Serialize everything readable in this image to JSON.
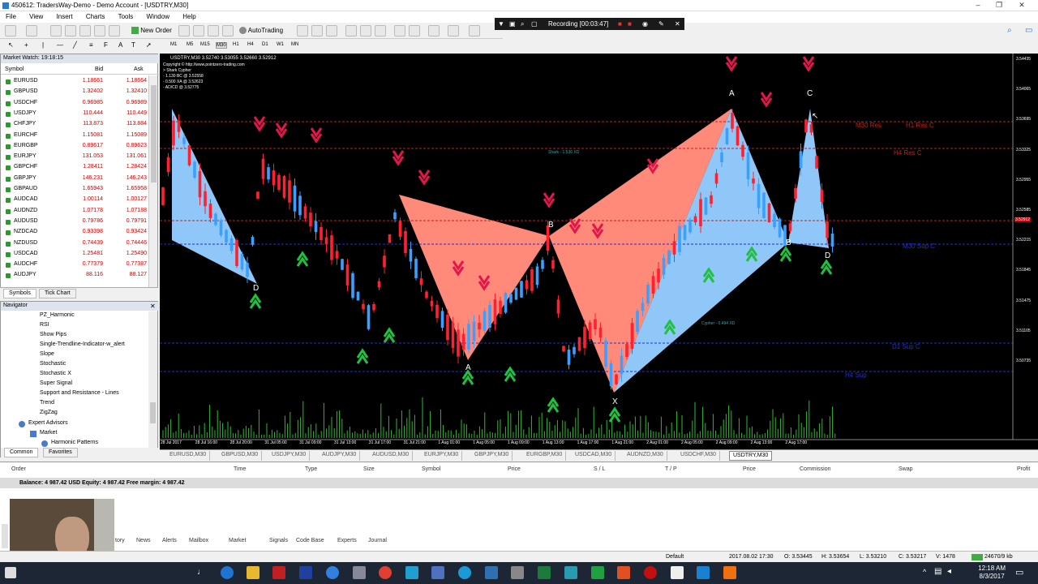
{
  "window": {
    "title": "450612: TradersWay-Demo - Demo Account - [USDTRY,M30]"
  },
  "menu": [
    "File",
    "View",
    "Insert",
    "Charts",
    "Tools",
    "Window",
    "Help"
  ],
  "toolbar": {
    "new_order": "New Order",
    "autotrading": "AutoTrading",
    "timeframes": [
      "M1",
      "M5",
      "M15",
      "M30",
      "H1",
      "H4",
      "D1",
      "W1",
      "MN"
    ]
  },
  "recording": {
    "label": "Recording [00:03:47]"
  },
  "market_watch": {
    "title": "Market Watch: 19:18:15",
    "col_symbol": "Symbol",
    "col_bid": "Bid",
    "col_ask": "Ask",
    "rows": [
      {
        "s": "EURUSD",
        "b": "1.18661",
        "a": "1.18664"
      },
      {
        "s": "GBPUSD",
        "b": "1.32402",
        "a": "1.32410"
      },
      {
        "s": "USDCHF",
        "b": "0.96985",
        "a": "0.96989"
      },
      {
        "s": "USDJPY",
        "b": "110.444",
        "a": "110.449"
      },
      {
        "s": "CHFJPY",
        "b": "113.873",
        "a": "113.884"
      },
      {
        "s": "EURCHF",
        "b": "1.15081",
        "a": "1.15089"
      },
      {
        "s": "EURGBP",
        "b": "0.89617",
        "a": "0.89623"
      },
      {
        "s": "EURJPY",
        "b": "131.053",
        "a": "131.061"
      },
      {
        "s": "GBPCHF",
        "b": "1.28411",
        "a": "1.28424"
      },
      {
        "s": "GBPJPY",
        "b": "146.231",
        "a": "146.243"
      },
      {
        "s": "GBPAUD",
        "b": "1.65943",
        "a": "1.65958"
      },
      {
        "s": "AUDCAD",
        "b": "1.00114",
        "a": "1.00127"
      },
      {
        "s": "AUDNZD",
        "b": "1.07178",
        "a": "1.07188"
      },
      {
        "s": "AUDUSD",
        "b": "0.79786",
        "a": "0.79791"
      },
      {
        "s": "NZDCAD",
        "b": "0.93398",
        "a": "0.93424"
      },
      {
        "s": "NZDUSD",
        "b": "0.74439",
        "a": "0.74446"
      },
      {
        "s": "USDCAD",
        "b": "1.25481",
        "a": "1.25490"
      },
      {
        "s": "AUDCHF",
        "b": "0.77379",
        "a": "0.77387"
      },
      {
        "s": "AUDJPY",
        "b": "88.116",
        "a": "88.127"
      }
    ],
    "tabs": [
      "Symbols",
      "Tick Chart"
    ]
  },
  "navigator": {
    "title": "Navigator",
    "items": [
      "PZ_Harmonic",
      "RSI",
      "Show Pips",
      "Single-Trendline-Indicator-w_alert",
      "Slope",
      "Stochastic",
      "Stochastic X",
      "Super Signal",
      "Support and Resistance - Lines",
      "Trend",
      "ZigZag"
    ],
    "expert": "Expert Advisors",
    "market": "Market",
    "harmonic": "Harmonic Patterns",
    "tabs": [
      "Common",
      "Favorites"
    ]
  },
  "chart": {
    "header": "USDTRY,M30  3.52740 3.53055 3.52660 3.52912",
    "copyright": "Copyright © http://www.pointzero-trading.com",
    "info": [
      "> Shark Cypher",
      "- 1.130 BC @ 3.52558",
      "- 0.500 XA @ 3.52623",
      "- AD/CD @ 3.52775"
    ],
    "levels": [
      "M30 Res",
      "H1 Res C",
      "H4 Res C",
      "M30 Sup C",
      "D1 Sup C",
      "H4 Sup"
    ],
    "labels": {
      "A": "A",
      "B": "B",
      "C": "C",
      "D": "D",
      "X": "X"
    },
    "shark": "Shark - 1.536 XD",
    "cypher": "Cypher - 0.494 XD",
    "prices": [
      "3.54435",
      "3.54065",
      "3.53695",
      "3.53325",
      "3.52955",
      "3.52585",
      "3.52215",
      "3.51845",
      "3.51475",
      "3.51105",
      "3.50735"
    ],
    "dates": [
      "28 Jul 2017",
      "28 Jul 16:00",
      "28 Jul 20:00",
      "31 Jul 05:00",
      "31 Jul 09:00",
      "31 Jul 13:00",
      "31 Jul 17:00",
      "31 Jul 21:00",
      "1 Aug 01:00",
      "1 Aug 05:00",
      "1 Aug 09:00",
      "1 Aug 13:00",
      "1 Aug 17:00",
      "1 Aug 21:00",
      "2 Aug 01:00",
      "2 Aug 05:00",
      "2 Aug 09:00",
      "2 Aug 13:00",
      "2 Aug 17:00"
    ],
    "price_tag": "3.52912"
  },
  "chart_tabs": [
    "EURUSD,M30",
    "GBPUSD,M30",
    "USDJPY,M30",
    "AUDJPY,M30",
    "AUDUSD,M30",
    "EURJPY,M30",
    "GBPJPY,M30",
    "EURGBP,M30",
    "USDCAD,M30",
    "AUDNZD,M30",
    "USDCHF,M30",
    "USDTRY,M30"
  ],
  "terminal": {
    "cols": [
      "Order",
      "Time",
      "Type",
      "Size",
      "Symbol",
      "Price",
      "S / L",
      "T / P",
      "Price",
      "Commission",
      "Swap",
      "Profit"
    ],
    "balance": "Balance: 4 987.42 USD  Equity: 4 987.42  Free margin: 4 987.42",
    "tabs": [
      "tory",
      "News",
      "Alerts",
      "Mailbox",
      "Market",
      "Signals",
      "Code Base",
      "Experts",
      "Journal"
    ]
  },
  "status": {
    "profile": "Default",
    "datetime": "2017.08.02 17:30",
    "open": "O: 3.53445",
    "high": "H: 3.53654",
    "low": "L: 3.53210",
    "close": "C: 3.53217",
    "volume": "V: 1478",
    "conn": "24670/9 kb"
  },
  "clock": {
    "time": "12:18 AM",
    "date": "8/3/2017"
  },
  "colors": {
    "bull": "#3aa0ff",
    "bear": "#ff2030",
    "buy_arrow": "#22c040",
    "sell_arrow": "#e0184a"
  }
}
